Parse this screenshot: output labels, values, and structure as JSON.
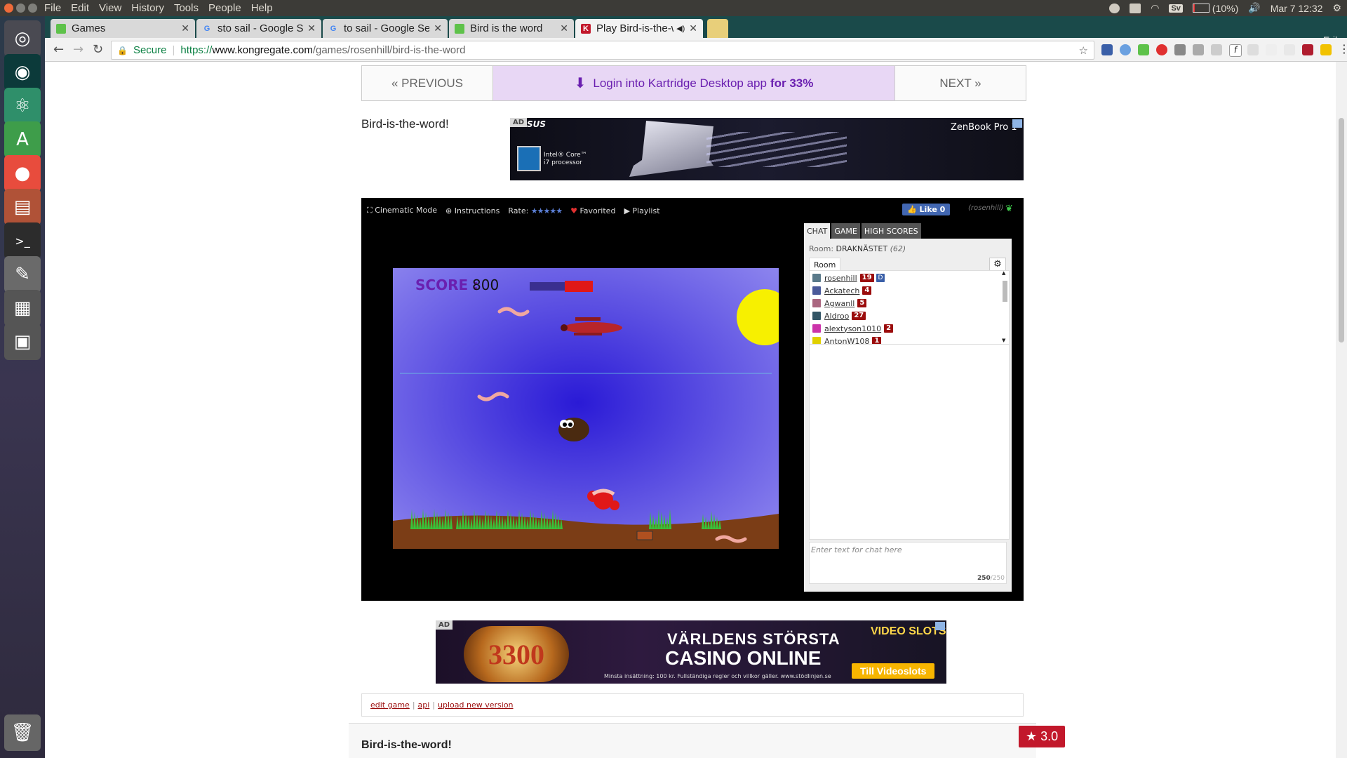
{
  "os": {
    "menu": [
      "File",
      "Edit",
      "View",
      "History",
      "Tools",
      "People",
      "Help"
    ],
    "tray": {
      "keyboard": "Sv",
      "battery": "(10%)",
      "clock": "Mar 7 12:32",
      "user": "Erik"
    }
  },
  "browser": {
    "tabs": [
      {
        "title": "Games",
        "icon": "green-game-icon"
      },
      {
        "title": "sto sail - Google Se",
        "icon": "google-icon"
      },
      {
        "title": "to sail - Google Sea",
        "icon": "google-icon"
      },
      {
        "title": "Bird is the word",
        "icon": "green-game-icon"
      },
      {
        "title": "Play Bird-is-the-w",
        "icon": "kongregate-icon"
      }
    ],
    "profile": "Erik",
    "secure_label": "Secure",
    "url": {
      "proto": "https://",
      "host": "www.kongregate.com",
      "path": "/games/rosenhill/bird-is-the-word"
    }
  },
  "page": {
    "nav": {
      "prev": "« PREVIOUS",
      "promo": "Login into Kartridge Desktop app",
      "promo_bold": "for 33%",
      "next": "NEXT »"
    },
    "game_title": "Bird-is-the-word!",
    "ad_top": {
      "badge": "AD",
      "brand": "SUS",
      "product": "ZenBook Pro 1",
      "cpu_line1": "Intel® Core™",
      "cpu_line2": "i7 processor"
    },
    "game_toolbar": {
      "cinematic": "Cinematic Mode",
      "instructions": "Instructions",
      "rate": "Rate:",
      "stars": "★★★★★",
      "favorited": "Favorited",
      "playlist": "Playlist",
      "like": "Like 0",
      "developer": "(rosenhill)"
    },
    "game": {
      "score_label": "SCORE :",
      "score": "800",
      "sky_top": "#8c84ee",
      "sky_center": "#2a1ad6",
      "ground": "#7b3d16",
      "grass": "#39c23a",
      "sun": "#f7f000"
    },
    "chat": {
      "tabs": [
        "CHAT",
        "GAME",
        "HIGH SCORES"
      ],
      "room_label": "Room:",
      "room_name": "DRAKNÄSTET",
      "room_count": "(62)",
      "room_tab": "Room",
      "users": [
        {
          "name": "rosenhill",
          "level": "19",
          "dev": "D",
          "color": "#5a7a8a"
        },
        {
          "name": "Ackatech",
          "level": "4",
          "dev": "",
          "color": "#4a5a9a"
        },
        {
          "name": "Agwanll",
          "level": "5",
          "dev": "",
          "color": "#aa6680"
        },
        {
          "name": "Aldroo",
          "level": "27",
          "dev": "",
          "color": "#335566"
        },
        {
          "name": "alextyson1010",
          "level": "2",
          "dev": "",
          "color": "#cc33aa"
        },
        {
          "name": "AntonW108",
          "level": "1",
          "dev": "",
          "color": "#e0d000"
        }
      ],
      "input_placeholder": "Enter text for chat here",
      "char_count": "250",
      "char_max": "/250"
    },
    "ad_bottom": {
      "badge": "AD",
      "slot_number": "3300",
      "headline1": "VÄRLDENS STÖRSTA",
      "headline2": "CASINO ONLINE",
      "cta": "Till Videoslots",
      "logo": "VIDEO SLOTS",
      "fine_print": "Minsta insättning: 100 kr. Fullständiga regler och villkor gäller. www.stödlinjen.se"
    },
    "dev_links": [
      "edit game",
      "api",
      "upload new version"
    ],
    "footer_title": "Bird-is-the-word!",
    "rating": "3.0"
  }
}
